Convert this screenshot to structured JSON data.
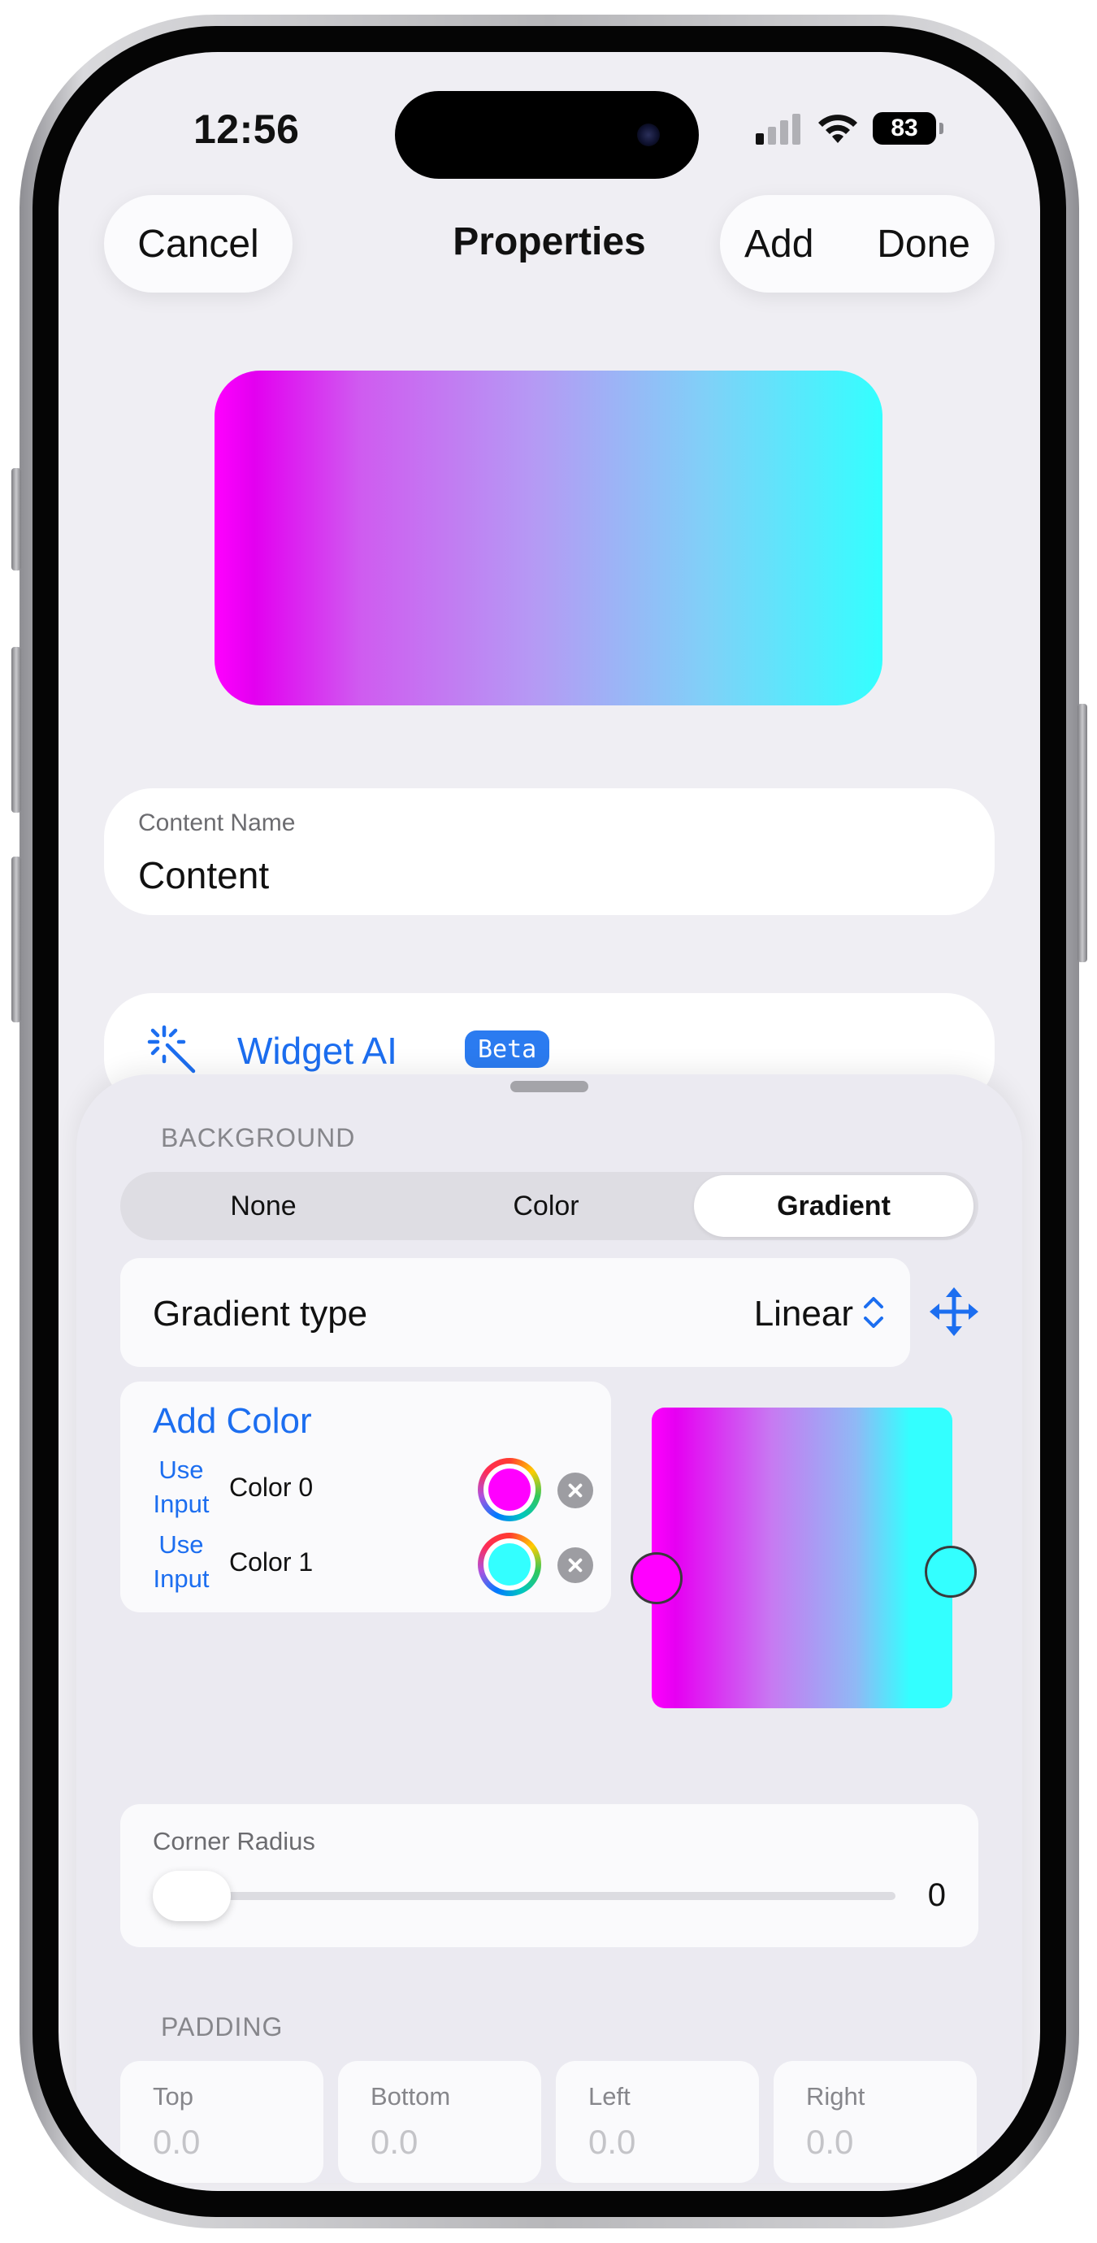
{
  "status_bar": {
    "time": "12:56",
    "battery": "83",
    "signal_icon": "cellular-signal-icon",
    "wifi_icon": "wifi-icon"
  },
  "nav": {
    "cancel": "Cancel",
    "title": "Properties",
    "add": "Add",
    "done": "Done"
  },
  "content_name": {
    "label": "Content Name",
    "value": "Content"
  },
  "widget_ai": {
    "label": "Widget AI",
    "badge": "Beta",
    "icon": "magic-wand-icon"
  },
  "background": {
    "section_label": "BACKGROUND",
    "options": [
      "None",
      "Color",
      "Gradient"
    ],
    "selected": "Gradient",
    "gradient_type_label": "Gradient type",
    "gradient_type_value": "Linear",
    "add_color": "Add Color",
    "colors": [
      {
        "use_input": "Use Input",
        "use_input_line1": "Use",
        "use_input_line2": "Input",
        "name": "Color 0",
        "hex": "#FF00FF"
      },
      {
        "use_input": "Use Input",
        "use_input_line1": "Use",
        "use_input_line2": "Input",
        "name": "Color 1",
        "hex": "#33FFFF"
      }
    ]
  },
  "corner_radius": {
    "label": "Corner Radius",
    "value": "0"
  },
  "padding": {
    "section_label": "PADDING",
    "fields": [
      {
        "label": "Top",
        "placeholder": "0.0"
      },
      {
        "label": "Bottom",
        "placeholder": "0.0"
      },
      {
        "label": "Left",
        "placeholder": "0.0"
      },
      {
        "label": "Right",
        "placeholder": "0.0"
      }
    ]
  },
  "colors": {
    "accent": "#1C6EF0",
    "background": "#EFEEF3",
    "gradient_start": "#FF00FF",
    "gradient_end": "#33FFFF"
  }
}
